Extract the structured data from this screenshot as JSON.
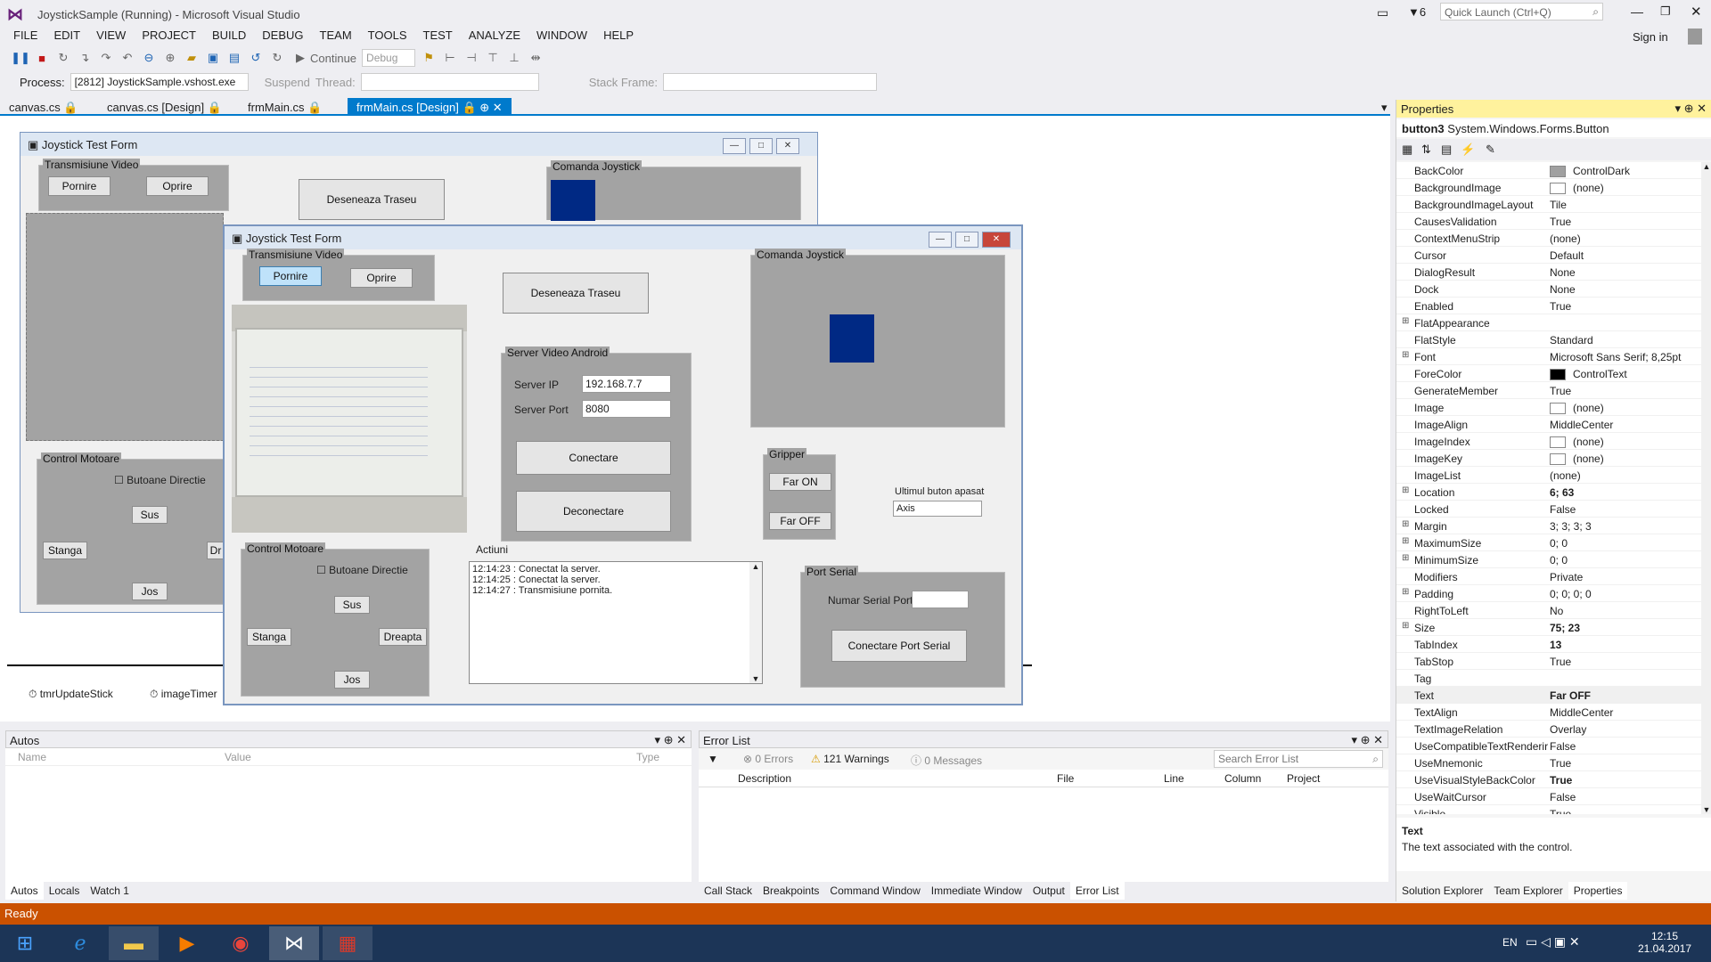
{
  "window": {
    "title": "JoystickSample (Running) - Microsoft Visual Studio",
    "notif_count": "6",
    "quick_launch": "Quick Launch (Ctrl+Q)",
    "sign_in": "Sign in"
  },
  "menu": [
    "FILE",
    "EDIT",
    "VIEW",
    "PROJECT",
    "BUILD",
    "DEBUG",
    "TEAM",
    "TOOLS",
    "TEST",
    "ANALYZE",
    "WINDOW",
    "HELP"
  ],
  "toolbar": {
    "continue": "Continue",
    "config": "Debug"
  },
  "process": {
    "label": "Process:",
    "value": "[2812] JoystickSample.vshost.exe",
    "suspend": "Suspend",
    "thread": "Thread:",
    "stack_frame": "Stack Frame:"
  },
  "tabs": [
    "canvas.cs",
    "canvas.cs [Design]",
    "frmMain.cs",
    "frmMain.cs [Design]"
  ],
  "design_form": {
    "title": "Joystick Test Form",
    "video_group": "Transmisiune Video",
    "pornire": "Pornire",
    "oprire": "Oprire",
    "deseneaza": "Deseneaza Traseu",
    "comanda": "Comanda Joystick",
    "motoare": "Control Motoare",
    "butoane": "Butoane Directie",
    "sus": "Sus",
    "stanga": "Stanga",
    "dr": "Dr",
    "jos": "Jos",
    "timer1": "tmrUpdateStick",
    "timer2": "imageTimer"
  },
  "run_form": {
    "title": "Joystick Test Form",
    "video_group": "Transmisiune Video",
    "pornire": "Pornire",
    "oprire": "Oprire",
    "deseneaza": "Deseneaza Traseu",
    "comanda": "Comanda Joystick",
    "server_group": "Server Video Android",
    "server_ip_label": "Server IP",
    "server_ip": "192.168.7.7",
    "server_port_label": "Server Port",
    "server_port": "8080",
    "conectare": "Conectare",
    "deconectare": "Deconectare",
    "gripper": "Gripper",
    "far_on": "Far ON",
    "far_off": "Far OFF",
    "ultimul_label": "Ultimul buton apasat",
    "ultimul_value": "Axis",
    "motoare": "Control Motoare",
    "butoane": "Butoane Directie",
    "sus": "Sus",
    "stanga": "Stanga",
    "dreapta": "Dreapta",
    "jos": "Jos",
    "actiuni": "Actiuni",
    "log": [
      "12:14:23  : Conectat la server.",
      "12:14:25  : Conectat la server.",
      "12:14:27  : Transmisiune pornita."
    ],
    "port_group": "Port Serial",
    "numar_port": "Numar Serial Port",
    "conectare_port": "Conectare Port Serial"
  },
  "properties": {
    "title": "Properties",
    "object": "button3",
    "object_type": "System.Windows.Forms.Button",
    "rows": [
      {
        "n": "BackColor",
        "v": "ControlDark",
        "sw": "#a0a0a0"
      },
      {
        "n": "BackgroundImage",
        "v": "(none)",
        "sw": "#ffffff"
      },
      {
        "n": "BackgroundImageLayout",
        "v": "Tile"
      },
      {
        "n": "CausesValidation",
        "v": "True"
      },
      {
        "n": "ContextMenuStrip",
        "v": "(none)"
      },
      {
        "n": "Cursor",
        "v": "Default"
      },
      {
        "n": "DialogResult",
        "v": "None"
      },
      {
        "n": "Dock",
        "v": "None"
      },
      {
        "n": "Enabled",
        "v": "True"
      },
      {
        "n": "FlatAppearance",
        "v": "",
        "e": true
      },
      {
        "n": "FlatStyle",
        "v": "Standard"
      },
      {
        "n": "Font",
        "v": "Microsoft Sans Serif; 8,25pt",
        "e": true
      },
      {
        "n": "ForeColor",
        "v": "ControlText",
        "sw": "#000000"
      },
      {
        "n": "GenerateMember",
        "v": "True"
      },
      {
        "n": "Image",
        "v": "(none)",
        "sw": "#ffffff"
      },
      {
        "n": "ImageAlign",
        "v": "MiddleCenter"
      },
      {
        "n": "ImageIndex",
        "v": "(none)",
        "sw": "#ffffff"
      },
      {
        "n": "ImageKey",
        "v": "(none)",
        "sw": "#ffffff"
      },
      {
        "n": "ImageList",
        "v": "(none)"
      },
      {
        "n": "Location",
        "v": "6; 63",
        "e": true,
        "b": true
      },
      {
        "n": "Locked",
        "v": "False"
      },
      {
        "n": "Margin",
        "v": "3; 3; 3; 3",
        "e": true
      },
      {
        "n": "MaximumSize",
        "v": "0; 0",
        "e": true
      },
      {
        "n": "MinimumSize",
        "v": "0; 0",
        "e": true
      },
      {
        "n": "Modifiers",
        "v": "Private"
      },
      {
        "n": "Padding",
        "v": "0; 0; 0; 0",
        "e": true
      },
      {
        "n": "RightToLeft",
        "v": "No"
      },
      {
        "n": "Size",
        "v": "75; 23",
        "e": true,
        "b": true
      },
      {
        "n": "TabIndex",
        "v": "13",
        "b": true
      },
      {
        "n": "TabStop",
        "v": "True"
      },
      {
        "n": "Tag",
        "v": ""
      },
      {
        "n": "Text",
        "v": "Far OFF",
        "b": true
      },
      {
        "n": "TextAlign",
        "v": "MiddleCenter"
      },
      {
        "n": "TextImageRelation",
        "v": "Overlay"
      },
      {
        "n": "UseCompatibleTextRenderir",
        "v": "False"
      },
      {
        "n": "UseMnemonic",
        "v": "True"
      },
      {
        "n": "UseVisualStyleBackColor",
        "v": "True",
        "b": true
      },
      {
        "n": "UseWaitCursor",
        "v": "False"
      },
      {
        "n": "Visible",
        "v": "True"
      }
    ],
    "desc_title": "Text",
    "desc_text": "The text associated with the control."
  },
  "autos": {
    "title": "Autos",
    "cols": [
      "Name",
      "Value",
      "Type"
    ],
    "tabs": [
      "Autos",
      "Locals",
      "Watch 1"
    ]
  },
  "errors": {
    "title": "Error List",
    "errors": "0 Errors",
    "warnings": "121 Warnings",
    "messages": "0 Messages",
    "search": "Search Error List",
    "cols": [
      "Description",
      "File",
      "Line",
      "Column",
      "Project"
    ],
    "tabs": [
      "Call Stack",
      "Breakpoints",
      "Command Window",
      "Immediate Window",
      "Output",
      "Error List"
    ]
  },
  "right_tabs": [
    "Solution Explorer",
    "Team Explorer",
    "Properties"
  ],
  "status": "Ready",
  "tray": {
    "lang": "EN",
    "time": "12:15",
    "date": "21.04.2017"
  }
}
